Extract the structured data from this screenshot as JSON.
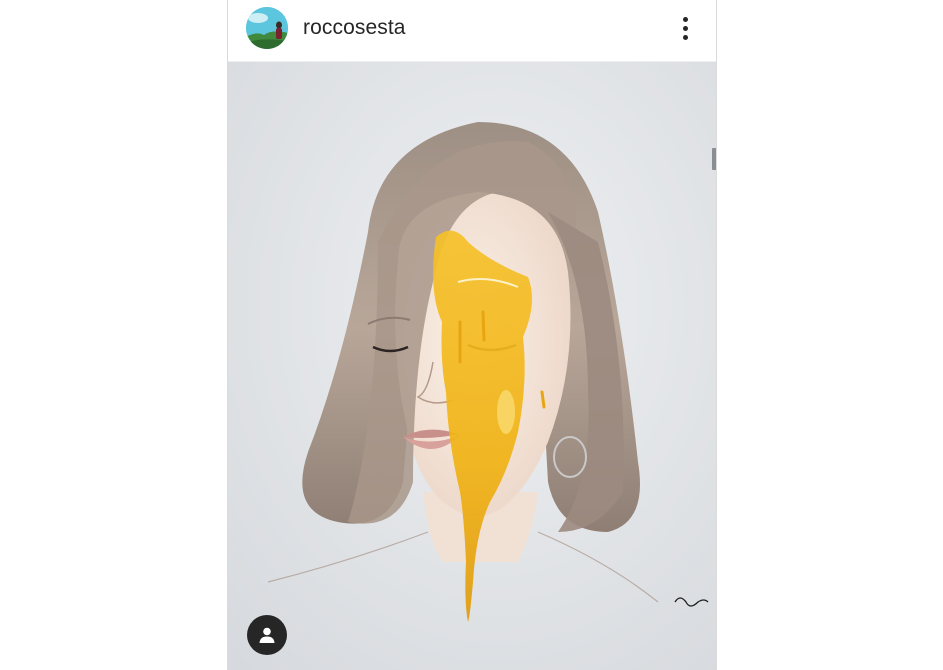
{
  "post": {
    "username": "roccosesta",
    "avatar_icon": "profile-avatar",
    "more_icon": "more-options-icon",
    "tag_icon": "user-tag-icon"
  },
  "artwork": {
    "signature": "Sesto"
  },
  "colors": {
    "text": "#262626",
    "divider": "#dbdbdb",
    "honey": "#f2b418"
  }
}
